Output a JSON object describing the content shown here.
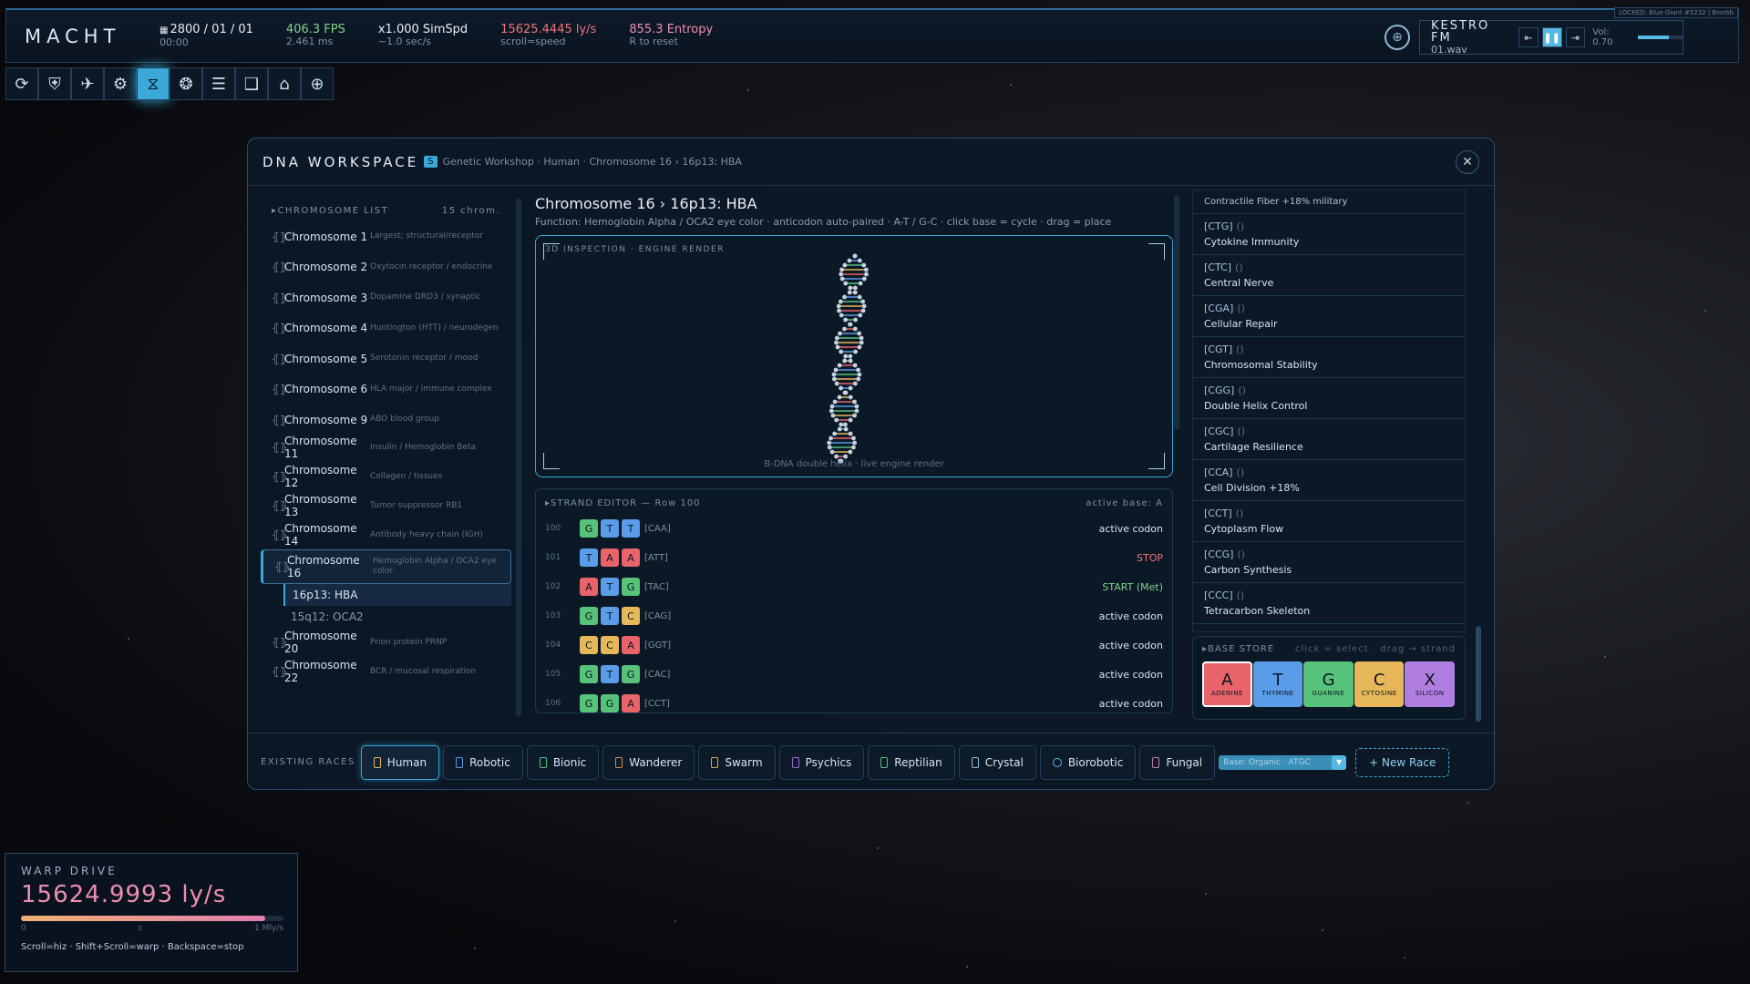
{
  "topbar": {
    "brand": "MACHT",
    "stats": [
      {
        "value": "2800 / 01 / 01",
        "sub": "00:00",
        "color": "white",
        "icon": "calendar-icon"
      },
      {
        "value": "406.3 FPS",
        "sub": "2.461 ms",
        "color": "green"
      },
      {
        "value": "x1.000 SimSpd",
        "sub": "~1.0 sec/s",
        "color": "white"
      },
      {
        "value": "15625.4445 ly/s",
        "sub": "scroll=speed",
        "color": "red"
      },
      {
        "value": "855.3 Entropy",
        "sub": "R to reset",
        "color": "pink"
      }
    ],
    "radio": {
      "title": "KESTRO FM",
      "file": "01.wav",
      "volume_label": "Vol: 0.70",
      "volume": 0.7,
      "locked_tag": "LOCKED: Blue Giant #5232 | Brorbb"
    }
  },
  "toolbar": [
    "refresh-icon",
    "shield-icon",
    "ship-icon",
    "gear-icon",
    "dna-icon",
    "brain-icon",
    "scroll-icon",
    "book-icon",
    "bank-icon",
    "crosshair-icon"
  ],
  "panel": {
    "title": "DNA WORKSPACE",
    "badge": "S",
    "breadcrumb": "Genetic Workshop · Human · Chromosome 16 › 16p13: HBA",
    "chromosome_header": "CHROMOSOME LIST",
    "chromosome_count": "15 chrom.",
    "chromosomes": [
      {
        "name": "Chromosome 1",
        "desc": "Largest; structural/receptor",
        "tall": false
      },
      {
        "name": "Chromosome 2",
        "desc": "Oxytocin receptor / endocrine",
        "tall": true
      },
      {
        "name": "Chromosome 3",
        "desc": "Dopamine DRD3 / synaptic",
        "tall": false
      },
      {
        "name": "Chromosome 4",
        "desc": "Huntington (HTT) / neurodegen",
        "tall": true
      },
      {
        "name": "Chromosome 5",
        "desc": "Serotonin receptor / mood",
        "tall": false
      },
      {
        "name": "Chromosome 6",
        "desc": "HLA major / immune complex",
        "tall": true
      },
      {
        "name": "Chromosome 9",
        "desc": "ABO blood group",
        "tall": false
      },
      {
        "name": "Chromosome 11",
        "desc": "Insulin / Hemoglobin Beta",
        "tall": false
      },
      {
        "name": "Chromosome 12",
        "desc": "Collagen / tissues",
        "tall": false
      },
      {
        "name": "Chromosome 13",
        "desc": "Tumor suppressor RB1",
        "tall": false
      },
      {
        "name": "Chromosome 14",
        "desc": "Antibody heavy chain (IGH)",
        "tall": false
      },
      {
        "name": "Chromosome 16",
        "desc": "Hemoglobin Alpha / OCA2 eye color",
        "tall": true,
        "active": true,
        "subs": [
          {
            "name": "16p13: HBA",
            "active": true
          },
          {
            "name": "15q12: OCA2",
            "active": false
          }
        ]
      },
      {
        "name": "Chromosome 20",
        "desc": "Prion protein PRNP",
        "tall": false
      },
      {
        "name": "Chromosome 22",
        "desc": "BCR / mucosal respiration",
        "tall": false
      }
    ],
    "center": {
      "title": "Chromosome 16 › 16p13: HBA",
      "subtitle": "Function: Hemoglobin Alpha / OCA2 eye color · anticodon auto-paired · A-T / G-C · click base = cycle · drag = place",
      "inspect_label": "3D INSPECTION · ENGINE RENDER",
      "render_label": "B-DNA double helix · live engine render"
    },
    "editor": {
      "title": "STRAND EDITOR — Row 100",
      "active_base": "active base: A",
      "rows": [
        {
          "num": "100",
          "bases": [
            "G",
            "T",
            "T"
          ],
          "anti": "[CAA]",
          "status": "active codon",
          "kind": ""
        },
        {
          "num": "101",
          "bases": [
            "T",
            "A",
            "A"
          ],
          "anti": "[ATT]",
          "status": "STOP",
          "kind": "stop"
        },
        {
          "num": "102",
          "bases": [
            "A",
            "T",
            "G"
          ],
          "anti": "[TAC]",
          "status": "START (Met)",
          "kind": "start"
        },
        {
          "num": "103",
          "bases": [
            "G",
            "T",
            "C"
          ],
          "anti": "[CAG]",
          "status": "active codon",
          "kind": ""
        },
        {
          "num": "104",
          "bases": [
            "C",
            "C",
            "A"
          ],
          "anti": "[GGT]",
          "status": "active codon",
          "kind": ""
        },
        {
          "num": "105",
          "bases": [
            "G",
            "T",
            "G"
          ],
          "anti": "[CAC]",
          "status": "active codon",
          "kind": ""
        },
        {
          "num": "106",
          "bases": [
            "G",
            "G",
            "A"
          ],
          "anti": "[CCT]",
          "status": "active codon",
          "kind": ""
        }
      ]
    },
    "codon_top": "Contractile Fiber +18% military",
    "codons": [
      {
        "code": "[CTG]",
        "unit": "()",
        "name": "Cytokine Immunity"
      },
      {
        "code": "[CTC]",
        "unit": "()",
        "name": "Central Nerve"
      },
      {
        "code": "[CGA]",
        "unit": "()",
        "name": "Cellular Repair"
      },
      {
        "code": "[CGT]",
        "unit": "()",
        "name": "Chromosomal Stability"
      },
      {
        "code": "[CGG]",
        "unit": "()",
        "name": "Double Helix Control"
      },
      {
        "code": "[CGC]",
        "unit": "()",
        "name": "Cartilage Resilience"
      },
      {
        "code": "[CCA]",
        "unit": "()",
        "name": "Cell Division +18%"
      },
      {
        "code": "[CCT]",
        "unit": "()",
        "name": "Cytoplasm Flow"
      },
      {
        "code": "[CCG]",
        "unit": "()",
        "name": "Carbon Synthesis"
      },
      {
        "code": "[CCC]",
        "unit": "()",
        "name": "Tetracarbon Skeleton"
      }
    ],
    "base_store": {
      "title": "BASE STORE",
      "hint": "click = select · drag → strand",
      "tiles": [
        {
          "letter": "A",
          "name": "ADENINE",
          "cls": "tA",
          "selected": true
        },
        {
          "letter": "T",
          "name": "THYMINE",
          "cls": "tT",
          "selected": false
        },
        {
          "letter": "G",
          "name": "GUANINE",
          "cls": "tG",
          "selected": false
        },
        {
          "letter": "C",
          "name": "CYTOSINE",
          "cls": "tC",
          "selected": false
        },
        {
          "letter": "X",
          "name": "SILICON",
          "cls": "tX",
          "selected": false
        }
      ]
    },
    "races_label": "EXISTING RACES",
    "races": [
      {
        "name": "Human",
        "color": "#e6b85a",
        "active": true
      },
      {
        "name": "Robotic",
        "color": "#5a9ce8"
      },
      {
        "name": "Bionic",
        "color": "#56c27a"
      },
      {
        "name": "Wanderer",
        "color": "#e08a4a"
      },
      {
        "name": "Swarm",
        "color": "#d9a94a"
      },
      {
        "name": "Psychics",
        "color": "#9a6ad8"
      },
      {
        "name": "Reptilian",
        "color": "#56c27a"
      },
      {
        "name": "Crystal",
        "color": "#8fb8d6"
      },
      {
        "name": "Biorobotic",
        "color": "#56b9e3",
        "round": true
      },
      {
        "name": "Fungal",
        "color": "#c07ab0"
      }
    ],
    "base_select": "Base: Organic · ATGC",
    "new_race": "+ New Race"
  },
  "warp": {
    "title": "WARP DRIVE",
    "value": "15624.9993 ly/s",
    "fill": 0.93,
    "scale": [
      "0",
      "c",
      "1 Mly/s"
    ],
    "help": "Scroll=hiz · Shift+Scroll=warp · Backspace=stop"
  }
}
